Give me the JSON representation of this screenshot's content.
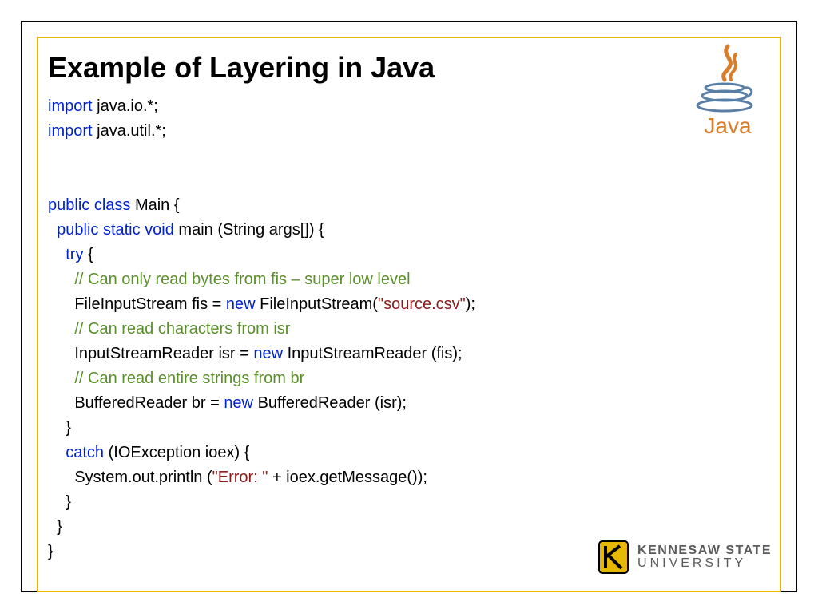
{
  "slide": {
    "title": "Example of Layering in Java"
  },
  "code": {
    "import_kw": "import",
    "import1_pkg": " java.io.*;",
    "import2_pkg": " java.util.*;",
    "public_class": "public class",
    "main_class": " Main {",
    "public_static_void": "public static void",
    "main_sig": " main (String args[]) {",
    "try": "try",
    "try_brace": " {",
    "comment1": "// Can only read bytes from fis – super low level",
    "line_fis_a": "      FileInputStream fis = ",
    "new": "new",
    "line_fis_b": " FileInputStream(",
    "string_src": "\"source.csv\"",
    "line_fis_c": ");",
    "comment2": "// Can read characters from isr",
    "line_isr_a": "      InputStreamReader isr = ",
    "line_isr_b": " InputStreamReader (fis);",
    "comment3": "// Can read entire strings from br",
    "line_br_a": "      BufferedReader br = ",
    "line_br_b": " BufferedReader (isr);",
    "close_try": "    }",
    "catch": "catch",
    "catch_sig": " (IOException ioex) {",
    "println_a": "      System.out.println (",
    "string_err": "\"Error: \"",
    "println_b": " + ioex.getMessage());",
    "close_catch": "    }",
    "close_main": "  }",
    "close_class": "}"
  },
  "logos": {
    "java_text": "Java",
    "ksu_line1": "KENNESAW STATE",
    "ksu_line2": "UNIVERSITY"
  }
}
